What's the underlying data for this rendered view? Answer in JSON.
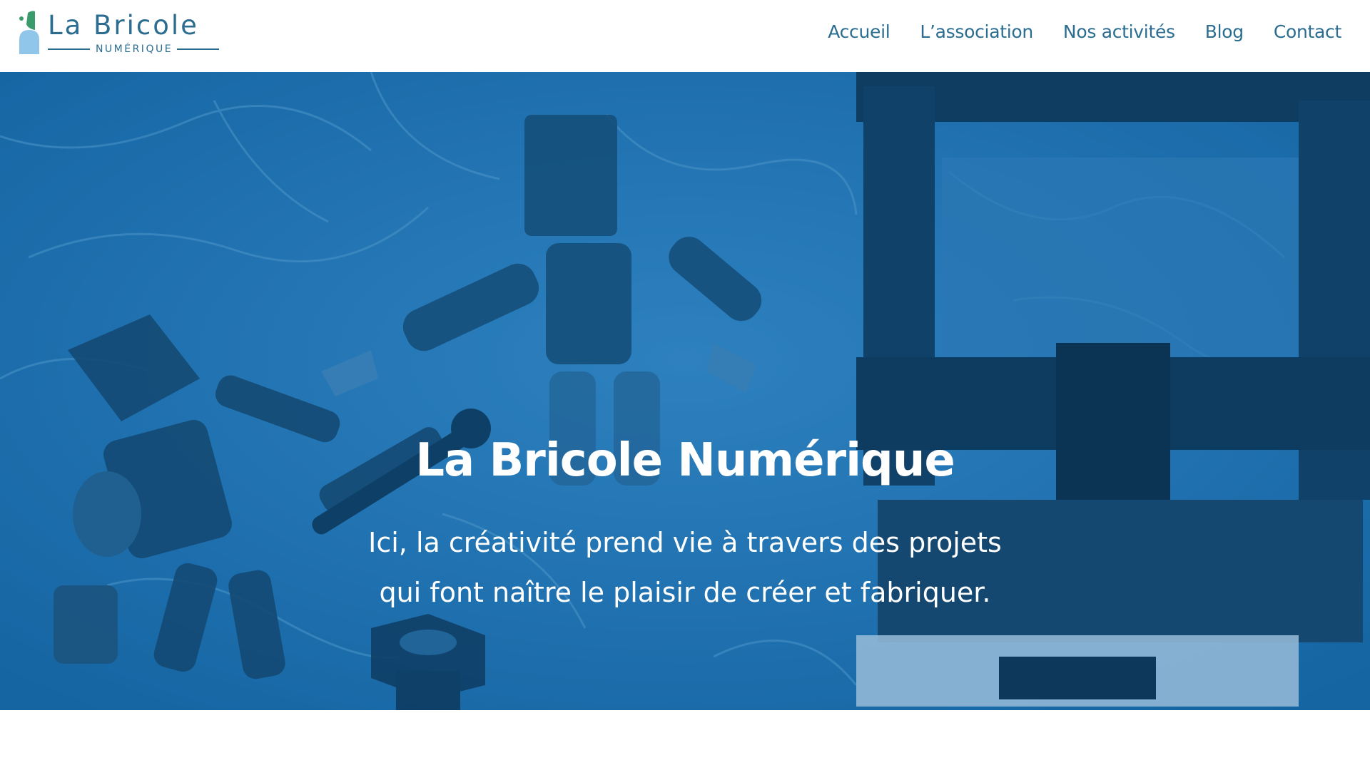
{
  "header": {
    "logo": {
      "title": "La Bricole",
      "subtitle": "NUMÉRIQUE"
    },
    "nav": [
      {
        "label": "Accueil"
      },
      {
        "label": "L’association"
      },
      {
        "label": "Nos activités"
      },
      {
        "label": "Blog"
      },
      {
        "label": "Contact"
      }
    ]
  },
  "hero": {
    "title": "La Bricole Numérique",
    "text_line1": "Ici, la créativité prend vie à travers des projets",
    "text_line2": "qui font naître le plaisir de créer et fabriquer.",
    "image_icon": "robot-figures-3d-printer-photo"
  },
  "colors": {
    "brand_blue": "#2b6d91",
    "hero_blue": "#1d74b0",
    "logo_green": "#3a9c6a",
    "logo_light_blue": "#8fc6ea"
  }
}
